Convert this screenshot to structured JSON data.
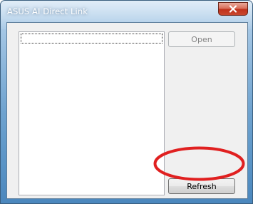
{
  "window": {
    "title": "ASUS AI Direct Link"
  },
  "titlebar": {
    "close_icon": "close-icon"
  },
  "device_list": {
    "items": []
  },
  "buttons": {
    "open_label": "Open",
    "open_enabled": false,
    "refresh_label": "Refresh",
    "refresh_enabled": true
  },
  "annotation": {
    "highlight_color": "#e02020",
    "target": "refresh-button"
  },
  "colors": {
    "close_button": "#c7422a"
  }
}
